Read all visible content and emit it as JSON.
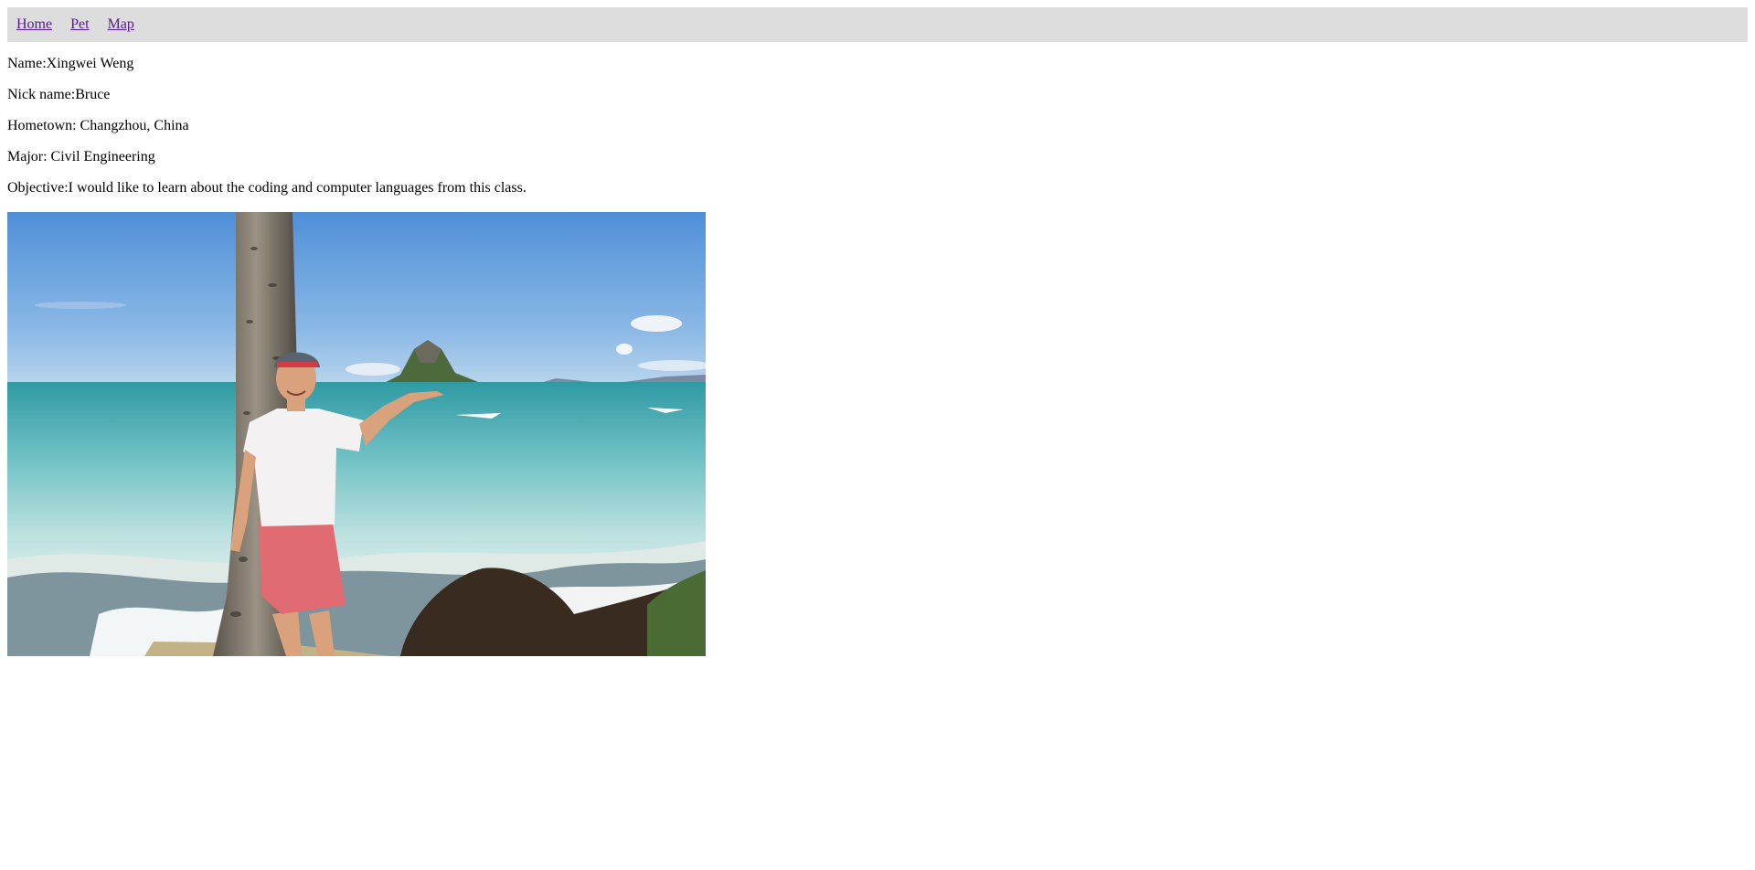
{
  "nav": {
    "links": [
      "Home",
      "Pet",
      "Map"
    ]
  },
  "profile": {
    "name": "Name:Xingwei Weng",
    "nickname": "Nick name:Bruce",
    "hometown": "Hometown: Changzhou, China",
    "major": "Major: Civil Engineering",
    "objective": "Objective:I would like to learn about the coding and computer languages from this class."
  },
  "colors": {
    "nav_background": "#dddddd",
    "visited_link": "#551a8b"
  }
}
